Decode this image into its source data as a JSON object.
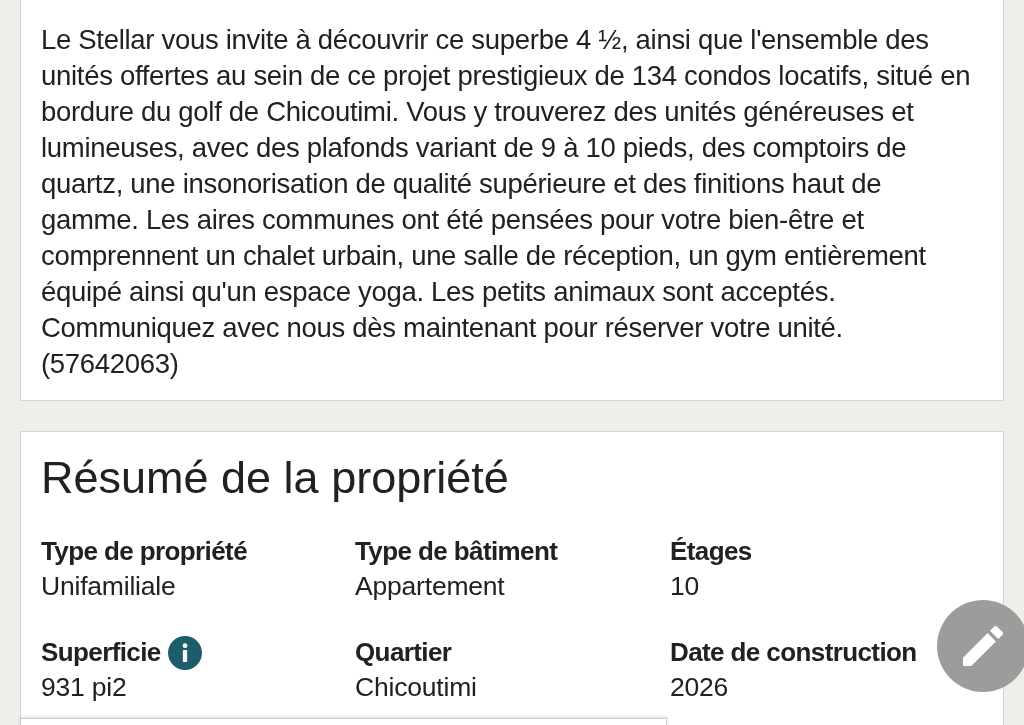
{
  "description": {
    "text": "Le Stellar vous invite à découvrir ce superbe 4 ½, ainsi que l'ensemble des unités offertes au sein de ce projet prestigieux de 134 condos locatifs, situé en bordure du golf de Chicoutimi. Vous y trouverez des unités généreuses et lumineuses, avec des plafonds variant de 9 à 10 pieds, des comptoirs de quartz, une insonorisation de qualité supérieure et des finitions haut de gamme. Les aires communes ont été pensées pour votre bien-être et comprennent un chalet urbain, une salle de réception, un gym entièrement équipé ainsi qu'un espace yoga. Les petits animaux sont acceptés. Communiquez avec nous dès maintenant pour réserver votre unité.",
    "reference": "(57642063)"
  },
  "property_summary": {
    "title": "Résumé de la propriété",
    "fields": [
      {
        "label": "Type de propriété",
        "value": "Unifamiliale",
        "info": false
      },
      {
        "label": "Type de bâtiment",
        "value": "Appartement",
        "info": false
      },
      {
        "label": "Étages",
        "value": "10",
        "info": false
      },
      {
        "label": "Superficie",
        "value": "931 pi2",
        "info": true
      },
      {
        "label": "Quartier",
        "value": "Chicoutimi",
        "info": false
      },
      {
        "label": "Date de construction",
        "value": "2026",
        "info": false
      }
    ]
  }
}
